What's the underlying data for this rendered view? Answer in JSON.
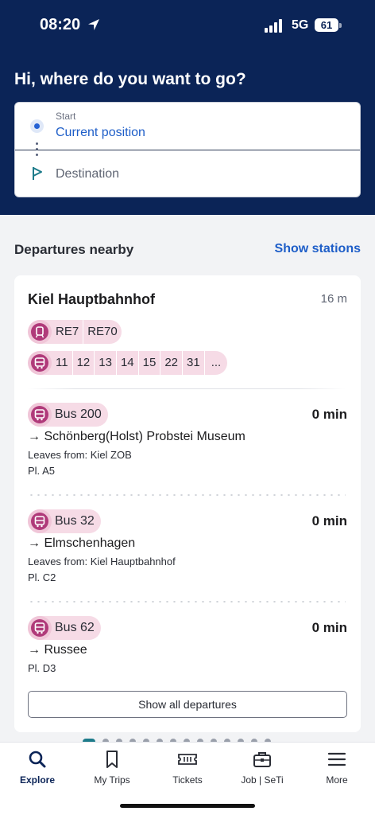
{
  "status_bar": {
    "time": "08:20",
    "network": "5G",
    "battery": "61"
  },
  "header": {
    "greeting": "Hi, where do you want to go?"
  },
  "search": {
    "start_label": "Start",
    "start_value": "Current position",
    "destination_placeholder": "Destination"
  },
  "nearby": {
    "title": "Departures nearby",
    "show_stations": "Show stations",
    "station": {
      "name": "Kiel Hauptbahnhof",
      "distance": "16 m",
      "train_lines": [
        "RE7",
        "RE70"
      ],
      "bus_lines": [
        "11",
        "12",
        "13",
        "14",
        "15",
        "22",
        "31",
        "..."
      ]
    },
    "departures": [
      {
        "line": "Bus 200",
        "time": "0 min",
        "direction": "→ Schönberg(Holst) Probstei Museum",
        "leaves_from": "Leaves from: Kiel ZOB",
        "platform": "Pl. A5"
      },
      {
        "line": "Bus 32",
        "time": "0 min",
        "direction": "→ Elmschenhagen",
        "leaves_from": "Leaves from: Kiel Hauptbahnhof",
        "platform": "Pl. C2"
      },
      {
        "line": "Bus 62",
        "time": "0 min",
        "direction": "→ Russee",
        "leaves_from": "",
        "platform": "Pl. D3"
      }
    ],
    "show_all": "Show all departures"
  },
  "pager": {
    "count": 14,
    "active_index": 0
  },
  "tabs": [
    {
      "label": "Explore",
      "icon": "search-icon"
    },
    {
      "label": "My Trips",
      "icon": "bookmark-icon"
    },
    {
      "label": "Tickets",
      "icon": "ticket-icon"
    },
    {
      "label": "Job | SeTi",
      "icon": "briefcase-icon"
    },
    {
      "label": "More",
      "icon": "menu-icon"
    }
  ],
  "colors": {
    "header_bg": "#0b2457",
    "accent": "#1e5ec8",
    "line_chip": "#f6dbe6",
    "mode_icon": "#b03a7a"
  }
}
